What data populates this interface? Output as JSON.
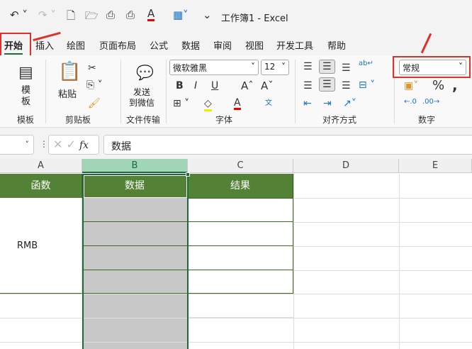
{
  "title": "工作簿1  -  Excel",
  "tabs": [
    "开始",
    "插入",
    "绘图",
    "页面布局",
    "公式",
    "数据",
    "审阅",
    "视图",
    "开发工具",
    "帮助"
  ],
  "ribbon": {
    "template_btn": "模板",
    "template_group": "模板",
    "paste": "粘贴",
    "clipboard_group": "剪贴板",
    "send_wechat_1": "发送",
    "send_wechat_2": "到微信",
    "file_group": "文件传输",
    "font_name": "微软雅黑",
    "font_size": "12",
    "font_group": "字体",
    "bold": "B",
    "italic": "I",
    "underline": "U",
    "align_group": "对齐方式",
    "number_format": "常规",
    "number_group": "数字"
  },
  "formula": {
    "fx": "fx",
    "value": "数据"
  },
  "columns": [
    "A",
    "B",
    "C",
    "D",
    "E"
  ],
  "cells": {
    "A1": "函数",
    "B1": "数据",
    "C1": "结果",
    "A2": "RMB"
  },
  "colors": {
    "header_green": "#538135",
    "selected_col": "#a0d5b8",
    "accent_red": "#e0302a"
  }
}
